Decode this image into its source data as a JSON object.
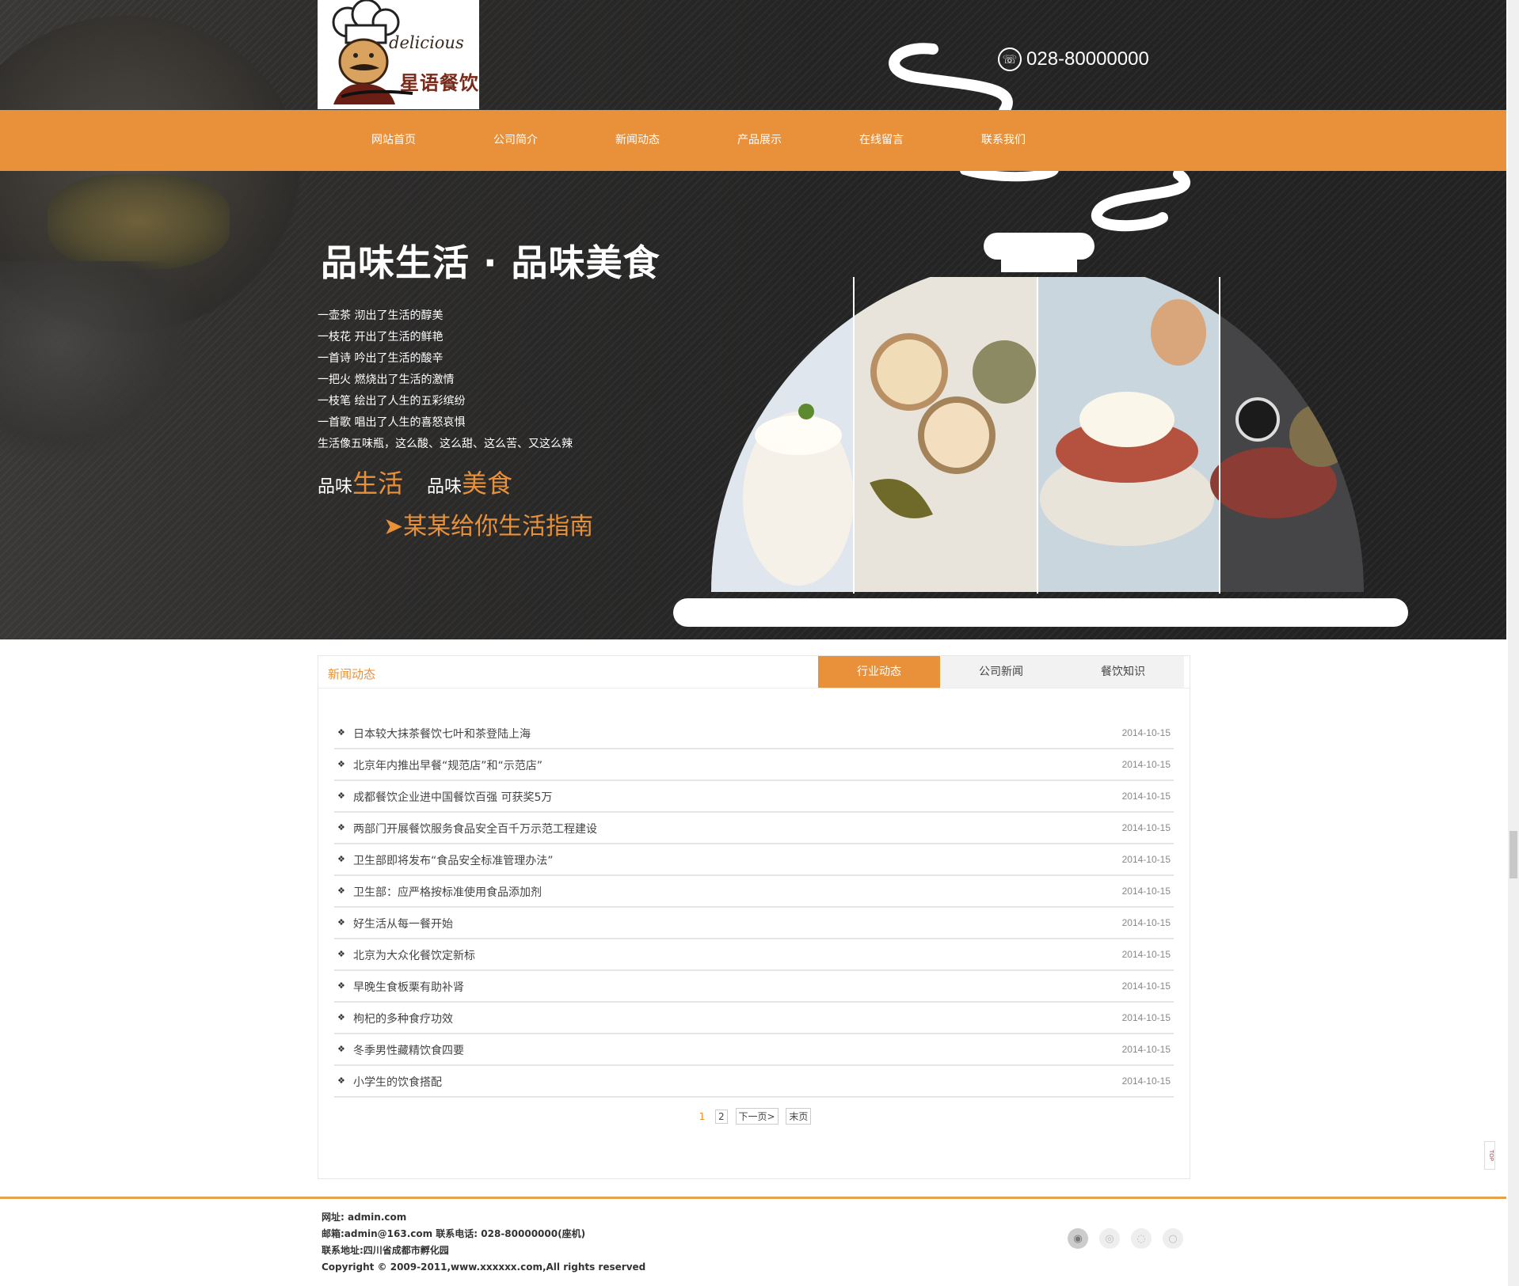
{
  "header": {
    "logo_en": "delicious",
    "logo_cn": "星语餐饮",
    "phone": "028-80000000"
  },
  "nav": {
    "items": [
      {
        "label": "网站首页"
      },
      {
        "label": "公司简介"
      },
      {
        "label": "新闻动态"
      },
      {
        "label": "产品展示"
      },
      {
        "label": "在线留言"
      },
      {
        "label": "联系我们"
      }
    ]
  },
  "hero": {
    "title": "品味生活 · 品味美食",
    "lines": [
      "一壶茶  沏出了生活的醇美",
      "一枝花  开出了生活的鲜艳",
      "一首诗  吟出了生活的酸辛",
      "一把火  燃烧出了生活的激情",
      "一枝笔  绘出了人生的五彩缤纷",
      "一首歌  唱出了人生的喜怒哀惧",
      "生活像五味瓶，这么酸、这么甜、这么苦、又这么辣"
    ],
    "slogan_prefix_1": "品味",
    "slogan_hl_1": "生活",
    "slogan_prefix_2": "品味",
    "slogan_hl_2": "美食",
    "guide": "➤某某给你生活指南"
  },
  "news": {
    "title": "新闻动态",
    "tabs": [
      {
        "label": "行业动态",
        "active": true
      },
      {
        "label": "公司新闻",
        "active": false
      },
      {
        "label": "餐饮知识",
        "active": false
      }
    ],
    "items": [
      {
        "title": "日本较大抹茶餐饮七叶和茶登陆上海",
        "date": "2014-10-15"
      },
      {
        "title": "北京年内推出早餐“规范店”和“示范店”",
        "date": "2014-10-15"
      },
      {
        "title": "成都餐饮企业进中国餐饮百强 可获奖5万",
        "date": "2014-10-15"
      },
      {
        "title": "两部门开展餐饮服务食品安全百千万示范工程建设",
        "date": "2014-10-15"
      },
      {
        "title": "卫生部即将发布“食品安全标准管理办法”",
        "date": "2014-10-15"
      },
      {
        "title": "卫生部：应严格按标准使用食品添加剂",
        "date": "2014-10-15"
      },
      {
        "title": "好生活从每一餐开始",
        "date": "2014-10-15"
      },
      {
        "title": "北京为大众化餐饮定新标",
        "date": "2014-10-15"
      },
      {
        "title": "早晚生食板栗有助补肾",
        "date": "2014-10-15"
      },
      {
        "title": "枸杞的多种食疗功效",
        "date": "2014-10-15"
      },
      {
        "title": "冬季男性藏精饮食四要",
        "date": "2014-10-15"
      },
      {
        "title": "小学生的饮食搭配",
        "date": "2014-10-15"
      }
    ],
    "pager": {
      "current": "1",
      "page2": "2",
      "next": "下一页>",
      "last": "末页"
    }
  },
  "footer": {
    "site": "网址: admin.com",
    "contact": "邮箱:admin@163.com  联系电话: 028-80000000(座机)",
    "address": "联系地址:四川省成都市孵化园",
    "copyright": "Copyright © 2009-2011,www.xxxxxx.com,All rights reserved"
  },
  "side": {
    "top_label": "TOP"
  },
  "colors": {
    "accent": "#e8903a",
    "dark_bg": "#262626"
  }
}
